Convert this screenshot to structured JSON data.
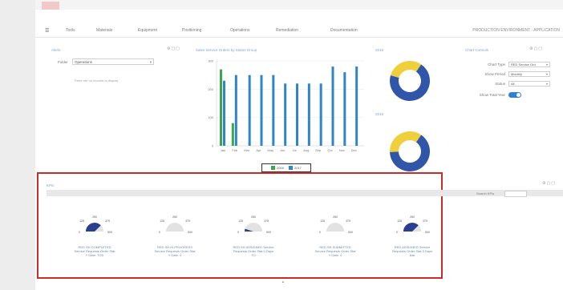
{
  "nav": {
    "menu_icon": "hamburger-icon",
    "items": [
      "Tools",
      "Materials",
      "Equipment",
      "Positioning",
      "Operations",
      "Remediation",
      "Documentation"
    ],
    "environment": "PRODUCTION ENVIRONMENT - APPLICATION"
  },
  "alerts": {
    "title": "Alerts",
    "folder_label": "Folder",
    "folder_value": "Operations",
    "empty_text": "There are no records to display"
  },
  "chart": {
    "title": "Sales Service Orders by Status Group",
    "donut1_label": "2016",
    "donut2_label": "2016"
  },
  "chart_options": {
    "title": "Chart Controls",
    "rows": [
      {
        "label": "Chart Type",
        "value": "RED Service Ord"
      },
      {
        "label": "Show Period",
        "value": "Monthly"
      },
      {
        "label": "Status",
        "value": "All"
      }
    ],
    "toggle_label": "Show Total Year",
    "toggle_on": true
  },
  "kpis": {
    "title": "KPIs",
    "search_label": "Search KPIs",
    "items": [
      {
        "value": 0.75,
        "labels": [
          "RED SH COMPLETED",
          "Service Requests Order Stat",
          "Y Date: TOD"
        ]
      },
      {
        "value": 0.0,
        "labels": [
          "RED SH IN PROGRESS",
          "Service Requests Order Stat",
          "Y Date: 0"
        ]
      },
      {
        "value": 0.1,
        "labels": [
          "RED SH ASSIGNED Service",
          "Requests Order Stat 0 Days",
          "TO"
        ]
      },
      {
        "value": 0.0,
        "labels": [
          "RED SH SUBMITTED",
          "Service Requests Order Stat",
          "Y Date: 0"
        ]
      },
      {
        "value": 0.75,
        "labels": [
          "RED ASSIGNED Service",
          "Requests Order Stat 3 Days",
          "Ask"
        ]
      }
    ],
    "gauge_ticks": {
      "min": "0",
      "low": "125",
      "mid": "250",
      "high": "375",
      "max": "500"
    }
  },
  "colors": {
    "green": "#3aa84a",
    "blue": "#2e86c9",
    "donut_blue": "#2f56a8",
    "donut_yellow": "#f0cf3c",
    "gauge_fill": "#2b3f8f",
    "gauge_empty": "#e2e2e2",
    "highlight": "#cc2b2b"
  },
  "chart_data": {
    "type": "bar",
    "title": "Sales Service Orders by Status Group",
    "categories": [
      "Jan",
      "Feb",
      "Mar",
      "Apr",
      "May",
      "Jun",
      "Jul",
      "Aug",
      "Sep",
      "Oct",
      "Nov",
      "Dec"
    ],
    "series": [
      {
        "name": "2016",
        "values": [
          270,
          80,
          null,
          null,
          null,
          null,
          null,
          null,
          null,
          null,
          null,
          null
        ]
      },
      {
        "name": "2017",
        "values": [
          230,
          250,
          250,
          250,
          250,
          220,
          220,
          220,
          220,
          280,
          260,
          280
        ]
      }
    ],
    "yticks": [
      "300",
      "200",
      "100",
      "0"
    ],
    "ylim": [
      0,
      300
    ],
    "grid": true,
    "legend": "bottom-center"
  },
  "donuts": [
    {
      "label": "2016",
      "slices": [
        {
          "name": "Blue",
          "value": 0.7
        },
        {
          "name": "Yellow",
          "value": 0.3
        }
      ]
    },
    {
      "label": "2016",
      "slices": [
        {
          "name": "Blue",
          "value": 0.65
        },
        {
          "name": "Yellow",
          "value": 0.35
        }
      ]
    }
  ]
}
